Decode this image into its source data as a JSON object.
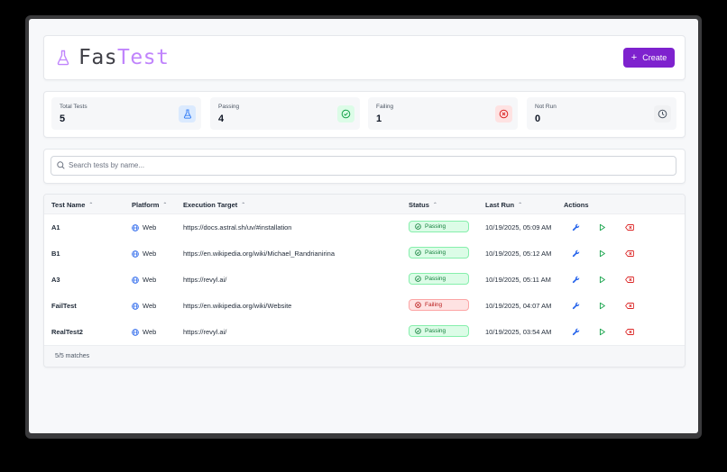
{
  "app": {
    "brand_part1": "Fas",
    "brand_part2": "Test",
    "create_label": "Create"
  },
  "stats": [
    {
      "label": "Total Tests",
      "value": "5",
      "icon": "flask-icon",
      "color": "#3b82f6"
    },
    {
      "label": "Passing",
      "value": "4",
      "icon": "check-circle-icon",
      "color": "#16a34a"
    },
    {
      "label": "Failing",
      "value": "1",
      "icon": "x-circle-icon",
      "color": "#dc2626"
    },
    {
      "label": "Not Run",
      "value": "0",
      "icon": "clock-icon",
      "color": "#4b5563"
    }
  ],
  "search": {
    "placeholder": "Search tests by name..."
  },
  "table": {
    "headers": {
      "name": "Test Name",
      "platform": "Platform",
      "target": "Execution Target",
      "status": "Status",
      "lastrun": "Last Run",
      "actions": "Actions"
    },
    "rows": [
      {
        "name": "A1",
        "platform": "Web",
        "target": "https://docs.astral.sh/uv/#installation",
        "status": "Passing",
        "last_run": "10/19/2025, 05:09 AM"
      },
      {
        "name": "B1",
        "platform": "Web",
        "target": "https://en.wikipedia.org/wiki/Michael_Randrianirina",
        "status": "Passing",
        "last_run": "10/19/2025, 05:12 AM"
      },
      {
        "name": "A3",
        "platform": "Web",
        "target": "https://revyl.ai/",
        "status": "Passing",
        "last_run": "10/19/2025, 05:11 AM"
      },
      {
        "name": "FailTest",
        "platform": "Web",
        "target": "https://en.wikipedia.org/wiki/Website",
        "status": "Failing",
        "last_run": "10/19/2025, 04:07 AM"
      },
      {
        "name": "RealTest2",
        "platform": "Web",
        "target": "https://revyl.ai/",
        "status": "Passing",
        "last_run": "10/19/2025, 03:54 AM"
      }
    ],
    "footer": "5/5 matches"
  },
  "colors": {
    "accent": "#7e22ce",
    "brand_light": "#c084fc",
    "pass": "#15803d",
    "fail": "#b91c1c",
    "edit_icon": "#2563eb",
    "run_icon": "#16a34a",
    "delete_icon": "#dc2626"
  }
}
